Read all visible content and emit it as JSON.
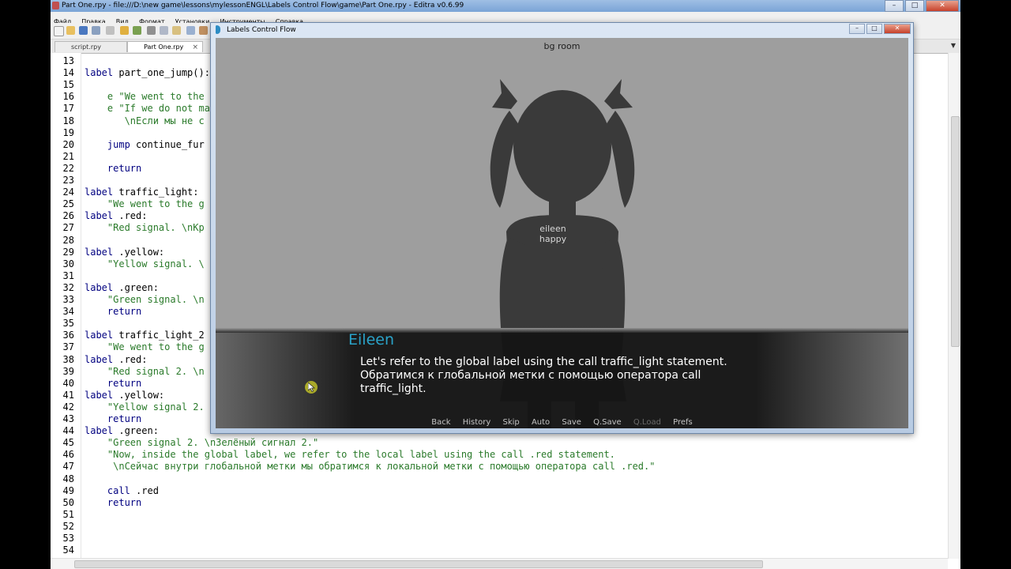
{
  "editra": {
    "title": "Part One.rpy - file:///D:\\new game\\lessons\\mylessonENGL\\Labels  Control Flow\\game\\Part One.rpy - Editra v0.6.99",
    "window_controls": [
      "–",
      "□",
      "✕"
    ],
    "menu": [
      "Файл",
      "Правка",
      "Вид",
      "Формат",
      "Установки",
      "Инструменты",
      "Справка"
    ],
    "tabs": [
      {
        "label": "script.rpy"
      },
      {
        "label": "Part One.rpy",
        "active": true
      }
    ],
    "line_numbers": [
      "13",
      "14",
      "15",
      "16",
      "17",
      "18",
      "19",
      "20",
      "21",
      "22",
      "23",
      "24",
      "25",
      "26",
      "27",
      "28",
      "29",
      "30",
      "31",
      "32",
      "33",
      "34",
      "35",
      "36",
      "37",
      "38",
      "39",
      "40",
      "41",
      "42",
      "43",
      "44",
      "45",
      "46",
      "47",
      "48",
      "49",
      "50",
      "51",
      "52",
      "53",
      "54"
    ],
    "code": [
      {
        "kw": "",
        "rest": ""
      },
      {
        "kw": "label",
        "rest": " part_one_jump():"
      },
      {
        "kw": "",
        "rest": ""
      },
      {
        "kw": "",
        "rest": "    e \"We went to the"
      },
      {
        "kw": "",
        "rest": "    e \"If we do not ma"
      },
      {
        "kw": "",
        "rest": "       \\nЕсли мы не с"
      },
      {
        "kw": "",
        "rest": ""
      },
      {
        "kw": "    jump",
        "rest": " continue_fur"
      },
      {
        "kw": "",
        "rest": ""
      },
      {
        "kw": "    return",
        "rest": ""
      },
      {
        "kw": "",
        "rest": ""
      },
      {
        "kw": "label",
        "rest": " traffic_light:"
      },
      {
        "kw": "",
        "rest": "    \"We went to the g"
      },
      {
        "kw": "label",
        "rest": " .red:"
      },
      {
        "kw": "",
        "rest": "    \"Red signal. \\nКр"
      },
      {
        "kw": "",
        "rest": ""
      },
      {
        "kw": "label",
        "rest": " .yellow:"
      },
      {
        "kw": "",
        "rest": "    \"Yellow signal. \\"
      },
      {
        "kw": "",
        "rest": ""
      },
      {
        "kw": "label",
        "rest": " .green:"
      },
      {
        "kw": "",
        "rest": "    \"Green signal. \\n"
      },
      {
        "kw": "    return",
        "rest": ""
      },
      {
        "kw": "",
        "rest": ""
      },
      {
        "kw": "label",
        "rest": " traffic_light_2"
      },
      {
        "kw": "",
        "rest": "    \"We went to the g"
      },
      {
        "kw": "label",
        "rest": " .red:"
      },
      {
        "kw": "",
        "rest": "    \"Red signal 2. \\n"
      },
      {
        "kw": "    return",
        "rest": ""
      },
      {
        "kw": "label",
        "rest": " .yellow:"
      },
      {
        "kw": "",
        "rest": "    \"Yellow signal 2."
      },
      {
        "kw": "    return",
        "rest": ""
      },
      {
        "kw": "label",
        "rest": " .green:"
      },
      {
        "kw": "",
        "rest": "    \"Green signal 2. \\nЗелёный сигнал 2.\""
      },
      {
        "kw": "",
        "rest": "    \"Now, inside the global label, we refer to the local label using the call .red statement."
      },
      {
        "kw": "",
        "rest": "     \\nСейчас внутри глобальной метки мы обратимся к локальной метки с помощью оператора call .red.\""
      },
      {
        "kw": "",
        "rest": ""
      },
      {
        "kw": "    call",
        "rest": " .red"
      },
      {
        "kw": "    return",
        "rest": ""
      },
      {
        "kw": "",
        "rest": ""
      },
      {
        "kw": "",
        "rest": ""
      },
      {
        "kw": "",
        "rest": ""
      },
      {
        "kw": "",
        "rest": ""
      }
    ]
  },
  "game": {
    "title": "Labels  Control Flow",
    "window_controls": [
      "–",
      "□",
      "✕"
    ],
    "bg_label": "bg room",
    "character_label": [
      "eileen",
      "happy"
    ],
    "speaker": "Eileen",
    "dialogue": [
      "Let's refer to the global label using the call traffic_light statement.",
      "Обратимся к глобальной метки с помощью оператора call traffic_light."
    ],
    "quick_menu": [
      {
        "label": "Back",
        "enabled": true
      },
      {
        "label": "History",
        "enabled": true
      },
      {
        "label": "Skip",
        "enabled": true
      },
      {
        "label": "Auto",
        "enabled": true
      },
      {
        "label": "Save",
        "enabled": true
      },
      {
        "label": "Q.Save",
        "enabled": true
      },
      {
        "label": "Q.Load",
        "enabled": false
      },
      {
        "label": "Prefs",
        "enabled": true
      }
    ],
    "colors": {
      "speaker": "#2aa3c9",
      "background": "#9e9e9e",
      "silhouette": "#3a3a3a"
    }
  }
}
